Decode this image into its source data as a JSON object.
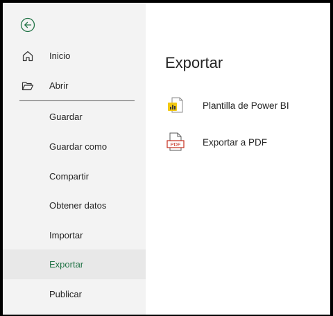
{
  "sidebar": {
    "back_icon": "back-arrow-circle-icon",
    "items": [
      {
        "label": "Inicio",
        "icon": "home-icon"
      },
      {
        "label": "Abrir",
        "icon": "folder-open-icon"
      },
      {
        "label": "Guardar"
      },
      {
        "label": "Guardar como"
      },
      {
        "label": "Compartir"
      },
      {
        "label": "Obtener datos"
      },
      {
        "label": "Importar"
      },
      {
        "label": "Exportar",
        "active": true
      },
      {
        "label": "Publicar"
      }
    ]
  },
  "main": {
    "title": "Exportar",
    "options": [
      {
        "label": "Plantilla de Power BI",
        "icon": "power-bi-template-icon"
      },
      {
        "label": "Exportar a PDF",
        "icon": "pdf-icon",
        "icon_text": "PDF"
      }
    ]
  },
  "colors": {
    "accent": "#217346",
    "sidebar_bg": "#f3f3f3",
    "active_bg": "#e8e8e8",
    "pbi_yellow": "#f2c811",
    "pdf_red": "#c42b1c"
  }
}
